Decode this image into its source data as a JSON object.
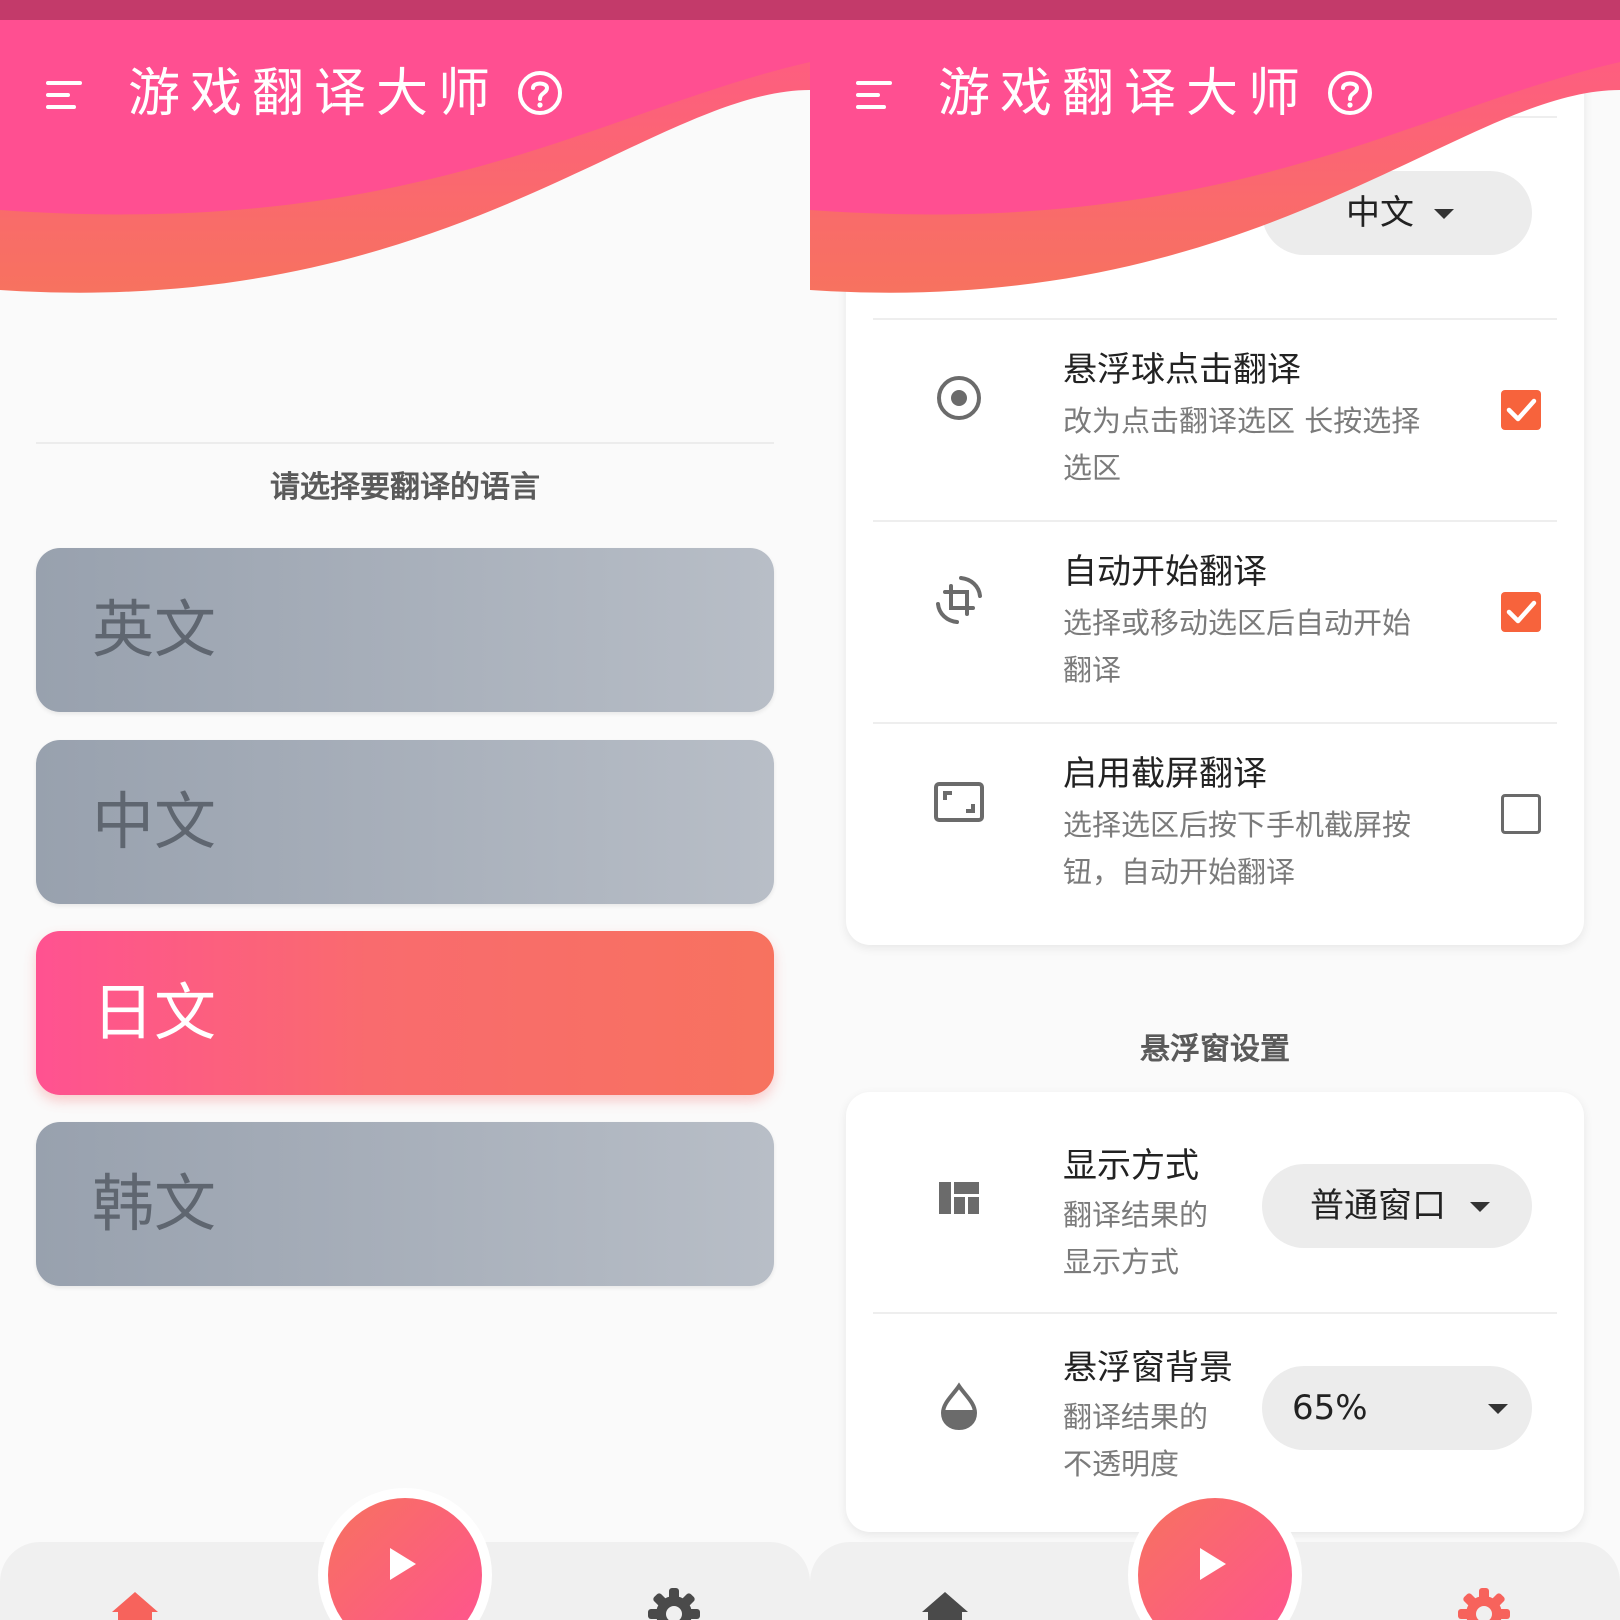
{
  "app": {
    "title": "游戏翻译大师"
  },
  "colors": {
    "accent": "#ff5291",
    "accent2": "#f7725f",
    "checkbox": "#f7633c"
  },
  "language_screen": {
    "heading": "请选择要翻译的语言",
    "options": [
      {
        "label": "英文",
        "selected": false
      },
      {
        "label": "中文",
        "selected": false
      },
      {
        "label": "日文",
        "selected": true
      },
      {
        "label": "韩文",
        "selected": false
      }
    ]
  },
  "settings_screen": {
    "partial_dropdown_value": "中文",
    "translate_settings": [
      {
        "title": "悬浮球点击翻译",
        "desc": "改为点击翻译选区 长按选择选区",
        "checked": true,
        "icon": "radio-target-icon"
      },
      {
        "title": "自动开始翻译",
        "desc": "选择或移动选区后自动开始翻译",
        "checked": true,
        "icon": "crop-rotate-icon"
      },
      {
        "title": "启用截屏翻译",
        "desc": "选择选区后按下手机截屏按钮，自动开始翻译",
        "checked": false,
        "icon": "screenshot-frame-icon"
      }
    ],
    "floating_section_title": "悬浮窗设置",
    "floating_settings": [
      {
        "title": "显示方式",
        "desc": "翻译结果的显示方式",
        "value": "普通窗口",
        "icon": "layout-grid-icon"
      },
      {
        "title": "悬浮窗背景",
        "desc": "翻译结果的不透明度",
        "value": "65%",
        "icon": "opacity-drop-icon"
      }
    ]
  },
  "nav": {
    "home_icon": "home-icon",
    "settings_icon": "gear-icon",
    "fab_icon": "play-icon"
  }
}
